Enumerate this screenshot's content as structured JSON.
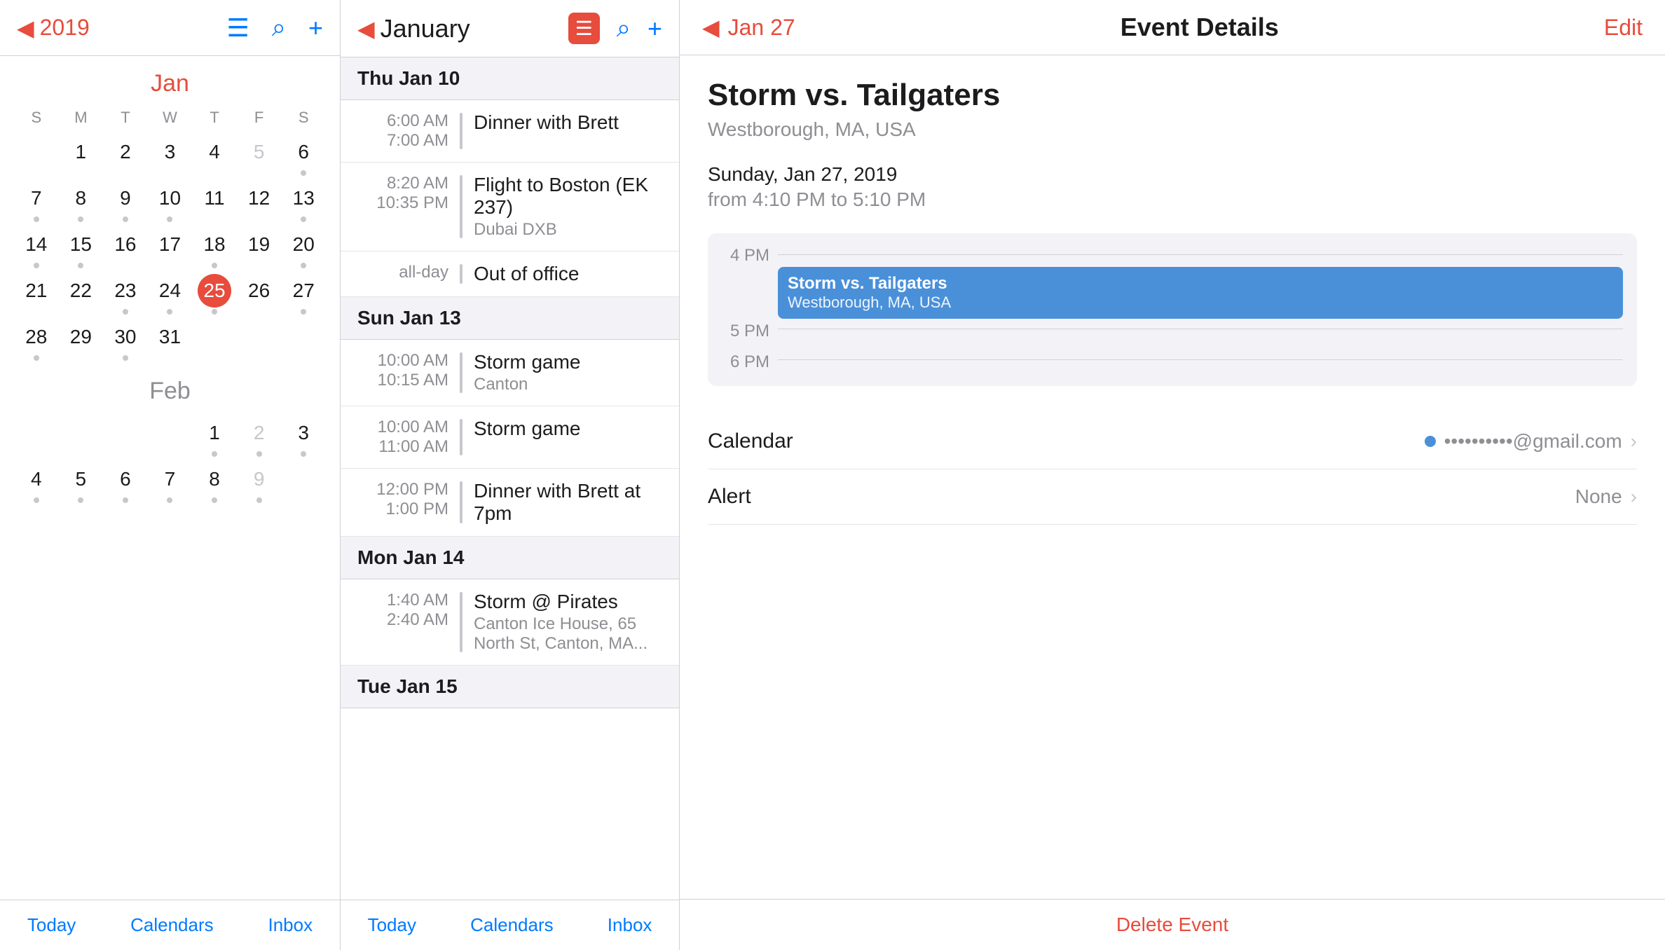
{
  "left": {
    "year": "2019",
    "back_arrow": "◀",
    "icons": {
      "list": "☰",
      "search": "⌕",
      "add": "+"
    },
    "jan_label": "Jan",
    "feb_label": "Feb",
    "dow": [
      "S",
      "M",
      "T",
      "W",
      "T",
      "F",
      "S"
    ],
    "jan_days": [
      {
        "n": "",
        "dot": false,
        "gray": true
      },
      {
        "n": "1",
        "dot": false
      },
      {
        "n": "2",
        "dot": false
      },
      {
        "n": "3",
        "dot": false
      },
      {
        "n": "4",
        "dot": false
      },
      {
        "n": "5",
        "dot": false,
        "gray": true
      },
      {
        "n": "6",
        "dot": true
      },
      {
        "n": "7",
        "dot": true
      },
      {
        "n": "8",
        "dot": true
      },
      {
        "n": "9",
        "dot": true
      },
      {
        "n": "10",
        "dot": true
      },
      {
        "n": "11",
        "dot": false
      },
      {
        "n": "12",
        "dot": false
      },
      {
        "n": "13",
        "dot": true
      },
      {
        "n": "14",
        "dot": true
      },
      {
        "n": "15",
        "dot": true
      },
      {
        "n": "16",
        "dot": false
      },
      {
        "n": "17",
        "dot": false
      },
      {
        "n": "18",
        "dot": true
      },
      {
        "n": "19",
        "dot": false
      },
      {
        "n": "20",
        "dot": true
      },
      {
        "n": "21",
        "dot": false
      },
      {
        "n": "22",
        "dot": false
      },
      {
        "n": "23",
        "dot": true
      },
      {
        "n": "24",
        "dot": true
      },
      {
        "n": "25",
        "dot": true,
        "today": true
      },
      {
        "n": "26",
        "dot": false
      },
      {
        "n": "27",
        "dot": true
      },
      {
        "n": "28",
        "dot": true
      },
      {
        "n": "29",
        "dot": false
      },
      {
        "n": "30",
        "dot": true
      },
      {
        "n": "31",
        "dot": false
      },
      {
        "n": "",
        "dot": false
      },
      {
        "n": "",
        "dot": false
      }
    ],
    "feb_days": [
      {
        "n": "",
        "dot": false
      },
      {
        "n": "",
        "dot": false
      },
      {
        "n": "",
        "dot": false
      },
      {
        "n": "",
        "dot": false
      },
      {
        "n": "1",
        "dot": true
      },
      {
        "n": "2",
        "dot": true,
        "gray": true
      },
      {
        "n": "3",
        "dot": true
      },
      {
        "n": "4",
        "dot": true
      },
      {
        "n": "5",
        "dot": true
      },
      {
        "n": "6",
        "dot": true
      },
      {
        "n": "7",
        "dot": true
      },
      {
        "n": "8",
        "dot": true
      },
      {
        "n": "9",
        "dot": true,
        "gray": true
      }
    ],
    "bottom": {
      "today": "Today",
      "calendars": "Calendars",
      "inbox": "Inbox"
    }
  },
  "middle": {
    "back_arrow": "◀",
    "title": "January",
    "list_icon": "☰",
    "search_icon": "⌕",
    "add_icon": "+",
    "events": [
      {
        "day_header": "Thu  Jan 10",
        "items": [
          {
            "t1": "6:00 AM",
            "t2": "7:00 AM",
            "title": "Dinner with Brett",
            "subtitle": ""
          },
          {
            "t1": "8:20 AM",
            "t2": "10:35 PM",
            "title": "Flight to Boston (EK 237)",
            "subtitle": "Dubai DXB"
          },
          {
            "t1": "all-day",
            "t2": "",
            "title": "Out of office",
            "subtitle": ""
          }
        ]
      },
      {
        "day_header": "Sun  Jan 13",
        "items": [
          {
            "t1": "10:00 AM",
            "t2": "10:15 AM",
            "title": "Storm game",
            "subtitle": "Canton"
          },
          {
            "t1": "10:00 AM",
            "t2": "11:00 AM",
            "title": "Storm game",
            "subtitle": ""
          }
        ]
      },
      {
        "no_day_header": true,
        "items": [
          {
            "t1": "12:00 PM",
            "t2": "1:00 PM",
            "title": "Dinner with Brett at 7pm",
            "subtitle": ""
          }
        ]
      },
      {
        "day_header": "Mon  Jan 14",
        "items": [
          {
            "t1": "1:40 AM",
            "t2": "2:40 AM",
            "title": "Storm @ Pirates",
            "subtitle": "Canton Ice House, 65 North St, Canton, MA..."
          }
        ]
      },
      {
        "day_header": "Tue  Jan 15",
        "items": []
      }
    ],
    "bottom": {
      "today": "Today",
      "calendars": "Calendars",
      "inbox": "Inbox"
    }
  },
  "right": {
    "back_arrow": "◀",
    "nav_label": "Jan 27",
    "header_title": "Event Details",
    "edit_label": "Edit",
    "event_title": "Storm vs. Tailgaters",
    "event_location": "Westborough, MA, USA",
    "event_date": "Sunday, Jan 27, 2019",
    "event_time": "from 4:10 PM to 5:10 PM",
    "timeline": {
      "labels": [
        "4 PM",
        "",
        "5 PM",
        "",
        "6 PM"
      ],
      "block_title": "Storm vs. Tailgaters",
      "block_sub": "Westborough, MA, USA"
    },
    "calendar_label": "Calendar",
    "calendar_value": "••••••••••@gmail.com",
    "alert_label": "Alert",
    "alert_value": "None",
    "chevron": "›",
    "delete_label": "Delete Event"
  }
}
